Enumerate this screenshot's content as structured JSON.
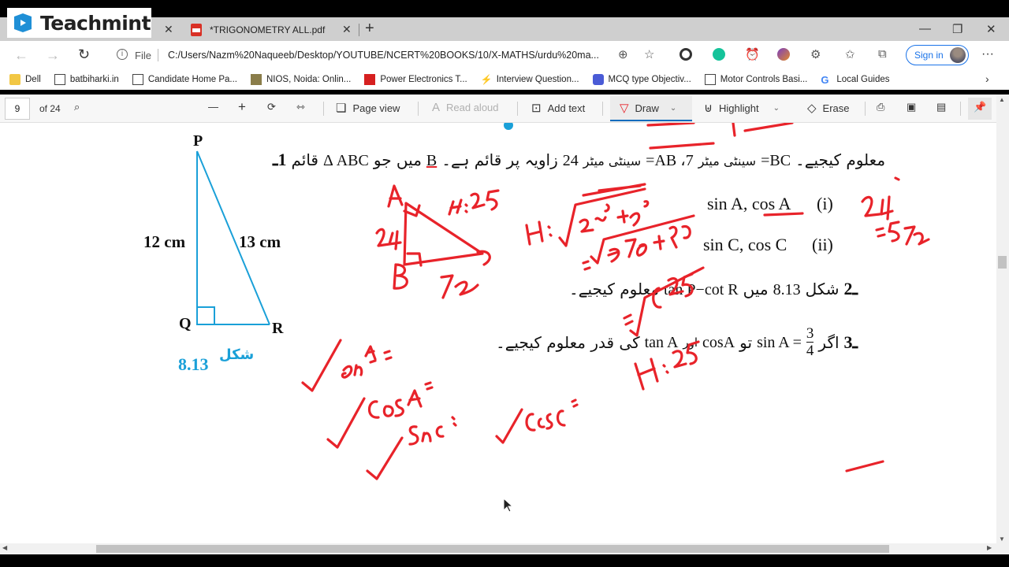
{
  "browser": {
    "brand_logo_text": "Teachmint",
    "tabs": [
      {
        "title": "*TRIGONOMETRY ALL.pdf",
        "icon": "pdf-icon",
        "active": true
      }
    ],
    "new_tab_icon": "+",
    "address": {
      "scheme_label": "File",
      "url": "C:/Users/Nazm%20Naqueeb/Desktop/YOUTUBE/NCERT%20BOOKS/10/X-MATHS/urdu%20ma..."
    },
    "sign_in_label": "Sign in",
    "more_icon": "···",
    "window_controls": {
      "minimize": "—",
      "restore": "❐",
      "close": "✕"
    },
    "bookmarks": [
      {
        "label": "Dell",
        "icon": "folder-icon"
      },
      {
        "label": "batbiharki.in",
        "icon": "page-icon"
      },
      {
        "label": "Candidate Home Pa...",
        "icon": "page-icon"
      },
      {
        "label": "NIOS, Noida: Onlin...",
        "icon": "nios-icon"
      },
      {
        "label": "Power Electronics T...",
        "icon": "job-icon"
      },
      {
        "label": "Interview Question...",
        "icon": "bolt-icon"
      },
      {
        "label": "MCQ type Objectiv...",
        "icon": "mcq-icon"
      },
      {
        "label": "Motor Controls Basi...",
        "icon": "page-icon"
      },
      {
        "label": "Local Guides",
        "icon": "google-icon"
      }
    ]
  },
  "pdf_toolbar": {
    "page_number": "9",
    "page_count_label": "of 24",
    "page_view_label": "Page view",
    "read_aloud_label": "Read aloud",
    "add_text_label": "Add text",
    "draw_label": "Draw",
    "highlight_label": "Highlight",
    "erase_label": "Erase",
    "zoom_out_icon": "—",
    "zoom_in_icon": "+"
  },
  "document": {
    "figure": {
      "vertices": {
        "P": "P",
        "Q": "Q",
        "R": "R"
      },
      "side_pq": "12 cm",
      "side_pr": "13 cm",
      "caption_number": "8.13",
      "caption_word": "شکل",
      "color": "#1aa0d8"
    },
    "questions": [
      {
        "number": "1ـ",
        "text": "قائم Δ ABC میں جو B زاویہ پر قائم ہے۔ 24 سینٹی میٹر AB = ،7 سینٹی میٹر BC = معلوم کیجیے۔"
      },
      {
        "number": "",
        "text": "sin A, cos A   (i)"
      },
      {
        "number": "",
        "text": "sin C, cos C   (ii)"
      },
      {
        "number": "2ـ",
        "text": "شکل 8.13 میں tan P − cot R معلوم کیجیے۔"
      },
      {
        "number": "3ـ",
        "text": "اگر sin A = 3/4 تو cos A اور tan A کی قدر معلوم کیجیے۔"
      }
    ],
    "q1_part_i": "sin A, cos A",
    "q1_part_i_num": "(i)",
    "q1_part_ii": "sin C, cos C",
    "q1_part_ii_num": "(ii)",
    "q1_number": "1ـ",
    "q1_urdu": "قائم",
    "q1_abc": "Δ ABC",
    "q1_mid": "میں جو",
    "q1_b": "B",
    "q1_mid2": "زاویہ پر قائم ہے۔",
    "q1_24": "24",
    "q1_cm": "سینٹی میٹر",
    "q1_ab": "7، AB=",
    "q1_cm2": "سینٹی میٹر",
    "q1_bc": "BC=",
    "q1_end": "معلوم کیجیے۔",
    "q2_number": "2ـ",
    "q2_fig": "شکل",
    "q2_num": "8.13",
    "q2_mein": "میں",
    "q2_expr": "tan P−cot R",
    "q2_end": "معلوم کیجیے۔",
    "q3_number": "3ـ",
    "q3_agar": "اگر",
    "q3_sin": "sin A =",
    "q3_frac_num": "3",
    "q3_frac_den": "4",
    "q3_to": "تو",
    "q3_cos": "cosA",
    "q3_aur": "اور",
    "q3_tan": "tan A",
    "q3_end": "کی قدر معلوم کیجیے۔"
  },
  "annotations": {
    "ink_color": "#e8232a",
    "items": [
      "A",
      "H:25",
      "24",
      "B",
      "7C",
      "H: √(24² + 7²)",
      "= √(576 + 49)",
      "= √625",
      "H = 25",
      "24² = 576",
      "✓ SinA =",
      "✓ CosA =",
      "✓ SinC =",
      "✓ CosC ="
    ]
  }
}
